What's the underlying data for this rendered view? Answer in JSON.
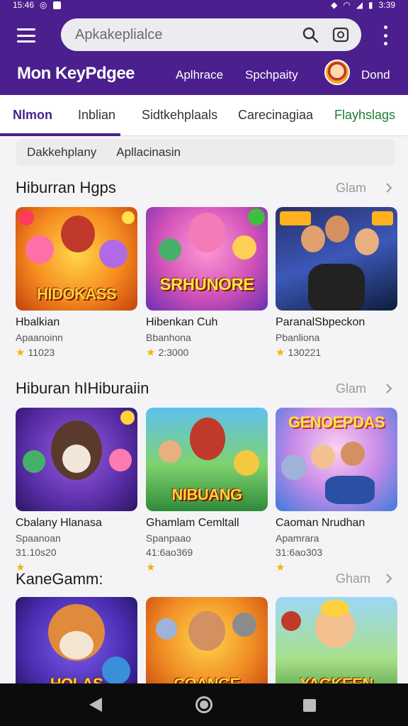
{
  "status_bar": {
    "time": "15:46",
    "battery": "3:39"
  },
  "search": {
    "placeholder": "Apkakeplialce"
  },
  "brand": {
    "title": "Mon KeyPdgee"
  },
  "appbar_links": [
    "Aplhrace",
    "Spchpaity"
  ],
  "user": {
    "name": "Dond"
  },
  "tabs": [
    {
      "label": "Nlmon",
      "active": true
    },
    {
      "label": "Inblian"
    },
    {
      "label": "Sidtkehplaals"
    },
    {
      "label": "Carecinagiaa"
    },
    {
      "label": "Flayhslags"
    }
  ],
  "chips": [
    "Dakkehplany",
    "Apllacinasin"
  ],
  "sections": [
    {
      "title": "Hiburran Hgps",
      "more": "Glam",
      "cards": [
        {
          "title": "Hbalkian",
          "subtitle": "Apaanoinn",
          "rating": "11023",
          "logo": "HIDOKASS"
        },
        {
          "title": "Hibenkan Cuh",
          "subtitle": "Bbanhona",
          "rating": "2:3000",
          "logo": "SRHUNORE"
        },
        {
          "title": "ParanalSbpeckon",
          "subtitle": "Pbanliona",
          "rating": "130221",
          "logo": ""
        }
      ]
    },
    {
      "title": "Hiburan hIHiburaiin",
      "more": "Glam",
      "cards": [
        {
          "title": "Cbalany Hlanasa",
          "subtitle": "Spaanoan",
          "rating": "31.10s20",
          "logo": ""
        },
        {
          "title": "Ghamlam Cemltall",
          "subtitle": "Spanpaao",
          "rating": "41:6ao369",
          "logo": "NIBUANG"
        },
        {
          "title": "Caoman Nrudhan",
          "subtitle": "Apamrara",
          "rating": "31:6ao303",
          "logo": "GENOEPDAS"
        }
      ]
    },
    {
      "title": "KaneGamm:",
      "more": "Gham",
      "cards": [
        {
          "title": "",
          "subtitle": "",
          "rating": "",
          "logo": "HOLAS"
        },
        {
          "title": "",
          "subtitle": "",
          "rating": "",
          "logo": "COANGE"
        },
        {
          "title": "",
          "subtitle": "",
          "rating": "",
          "logo": "YAGKEEN"
        }
      ]
    }
  ],
  "colors": {
    "brand": "#4b1f8e",
    "star": "#f5b400",
    "active_tab": "#4b1f8e",
    "green_tab": "#1e7d33"
  }
}
